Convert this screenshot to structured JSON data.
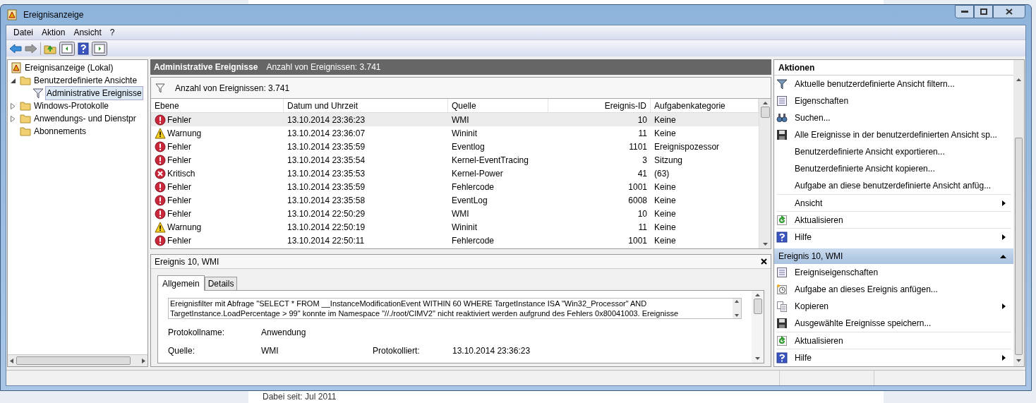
{
  "background": {
    "bottom_text": "Dabei seit: Jul 2011"
  },
  "window": {
    "title": "Ereignisanzeige"
  },
  "menu": [
    "Datei",
    "Aktion",
    "Ansicht",
    "?"
  ],
  "tree": [
    {
      "label": "Ereignisanzeige (Lokal)",
      "kind": "viewer",
      "children": [
        {
          "label": "Benutzerdefinierte Ansichte",
          "kind": "folder",
          "expanded": true,
          "children": [
            {
              "label": "Administrative Ereignisse",
              "kind": "filter",
              "selected": true
            }
          ]
        },
        {
          "label": "Windows-Protokolle",
          "kind": "folder",
          "expanded": false
        },
        {
          "label": "Anwendungs- und Dienstpr",
          "kind": "folder",
          "expanded": false
        },
        {
          "label": "Abonnements",
          "kind": "folder"
        }
      ]
    }
  ],
  "main": {
    "title": "Administrative Ereignisse",
    "count": "Anzahl von Ereignissen: 3.741",
    "filter_text": "Anzahl von Ereignissen: 3.741",
    "columns": [
      "Ebene",
      "Datum und Uhrzeit",
      "Quelle",
      "Ereignis-ID",
      "Aufgabenkategorie"
    ],
    "rows": [
      {
        "kind": "error",
        "level": "Fehler",
        "date": "13.10.2014 23:36:23",
        "source": "WMI",
        "id": "10",
        "category": "Keine",
        "selected": true
      },
      {
        "kind": "warning",
        "level": "Warnung",
        "date": "13.10.2014 23:36:07",
        "source": "Wininit",
        "id": "11",
        "category": "Keine",
        "selected": false
      },
      {
        "kind": "error",
        "level": "Fehler",
        "date": "13.10.2014 23:35:59",
        "source": "Eventlog",
        "id": "1101",
        "category": "Ereignispozessor",
        "selected": false
      },
      {
        "kind": "error",
        "level": "Fehler",
        "date": "13.10.2014 23:35:54",
        "source": "Kernel-EventTracing",
        "id": "3",
        "category": "Sitzung",
        "selected": false
      },
      {
        "kind": "critical",
        "level": "Kritisch",
        "date": "13.10.2014 23:35:53",
        "source": "Kernel-Power",
        "id": "41",
        "category": "(63)",
        "selected": false
      },
      {
        "kind": "error",
        "level": "Fehler",
        "date": "13.10.2014 23:35:59",
        "source": "Fehlercode",
        "id": "1001",
        "category": "Keine",
        "selected": false
      },
      {
        "kind": "error",
        "level": "Fehler",
        "date": "13.10.2014 23:35:58",
        "source": "EventLog",
        "id": "6008",
        "category": "Keine",
        "selected": false
      },
      {
        "kind": "error",
        "level": "Fehler",
        "date": "13.10.2014 22:50:29",
        "source": "WMI",
        "id": "10",
        "category": "Keine",
        "selected": false
      },
      {
        "kind": "warning",
        "level": "Warnung",
        "date": "13.10.2014 22:50:19",
        "source": "Wininit",
        "id": "11",
        "category": "Keine",
        "selected": false
      },
      {
        "kind": "error",
        "level": "Fehler",
        "date": "13.10.2014 22:50:11",
        "source": "Fehlercode",
        "id": "1001",
        "category": "Keine",
        "selected": false
      }
    ]
  },
  "detail": {
    "title": "Ereignis 10, WMI",
    "tabs": [
      {
        "label": "Allgemein",
        "selected": true
      },
      {
        "label": "Details",
        "selected": false
      }
    ],
    "description": "Ereignisfilter mit Abfrage \"SELECT * FROM __InstanceModificationEvent WITHIN 60 WHERE TargetInstance ISA \"Win32_Processor\" AND TargetInstance.LoadPercentage > 99\" konnte im Namespace \"//./root/CIMV2\" nicht reaktiviert werden aufgrund des Fehlers 0x80041003. Ereignisse",
    "fields": [
      [
        {
          "label": "Protokollname:",
          "value": "Anwendung"
        }
      ],
      [
        {
          "label": "Quelle:",
          "value": "WMI"
        },
        {
          "label": "Protokolliert:",
          "value": "13.10.2014 23:36:23"
        }
      ]
    ]
  },
  "actions": [
    {
      "title": "Aktionen",
      "items": [
        {
          "kind": "filter",
          "label": "Aktuelle benutzerdefinierte Ansicht filtern...",
          "submenu": false
        },
        {
          "kind": "properties",
          "label": "Eigenschaften",
          "submenu": false
        },
        {
          "kind": "find",
          "label": "Suchen...",
          "submenu": false
        },
        {
          "kind": "save",
          "label": "Alle Ereignisse in der benutzerdefinierten Ansicht sp...",
          "submenu": false
        },
        {
          "kind": "plain",
          "label": "Benutzerdefinierte Ansicht exportieren...",
          "submenu": false
        },
        {
          "kind": "plain",
          "label": "Benutzerdefinierte Ansicht kopieren...",
          "submenu": false
        },
        {
          "kind": "plain",
          "label": "Aufgabe an diese benutzerdefinierte Ansicht anfüg...",
          "submenu": false
        },
        {
          "kind": "plain",
          "label": "Ansicht",
          "submenu": true
        },
        {
          "kind": "refresh",
          "label": "Aktualisieren",
          "submenu": false
        },
        {
          "kind": "help",
          "label": "Hilfe",
          "submenu": true
        }
      ]
    },
    {
      "title": "Ereignis 10, WMI",
      "expanded": true,
      "items": [
        {
          "kind": "properties",
          "label": "Ereigniseigenschaften",
          "submenu": false
        },
        {
          "kind": "clock",
          "label": "Aufgabe an dieses Ereignis anfügen...",
          "submenu": false
        },
        {
          "kind": "copy",
          "label": "Kopieren",
          "submenu": true
        },
        {
          "kind": "save",
          "label": "Ausgewählte Ereignisse speichern...",
          "submenu": false
        },
        {
          "kind": "refresh",
          "label": "Aktualisieren",
          "submenu": false
        },
        {
          "kind": "help",
          "label": "Hilfe",
          "submenu": true
        }
      ]
    }
  ]
}
